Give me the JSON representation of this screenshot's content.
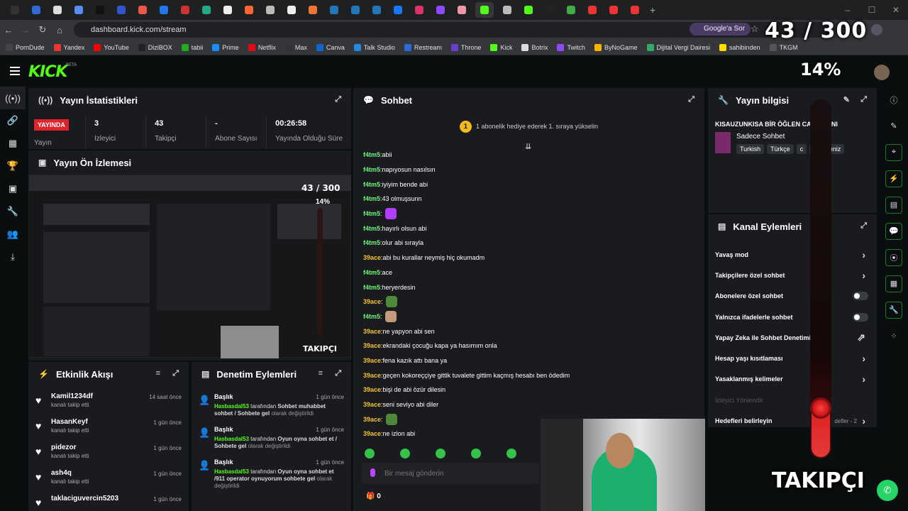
{
  "browser": {
    "url": "dashboard.kick.com/stream",
    "google_chip": "Google'a Sor",
    "bookmarks": [
      "PornDude",
      "Yandex",
      "YouTube",
      "DiziBOX",
      "tabii",
      "Prime",
      "Netflix",
      "Max",
      "Canva",
      "Talk Studio",
      "Restream",
      "Throne",
      "Kick",
      "Botrix",
      "Twitch",
      "ByNoGame",
      "Dijital Vergi Dairesi",
      "sahibinden",
      "TKGM"
    ],
    "bookmark_colors": [
      "#444",
      "#e33",
      "#f00",
      "#222",
      "#2a2",
      "#1a8cff",
      "#e50914",
      "#333",
      "#16c",
      "#2288dd",
      "#2a6bd8",
      "#6a3fd0",
      "#53fc18",
      "#ddd",
      "#9146ff",
      "#ffb400",
      "#3a6",
      "#ffdd00",
      "#555"
    ]
  },
  "header": {
    "logo": "KICK",
    "beta": "BETA"
  },
  "overlay": {
    "count": "43 / 300",
    "percent": "14%",
    "label": "TAKIPÇI",
    "progress": 0.14
  },
  "stats_panel": {
    "title": "Yayın İstatistikleri",
    "live_badge": "YAYINDA",
    "live_label": "Yayın",
    "viewers_value": "3",
    "viewers_label": "İzleyici",
    "followers_value": "43",
    "followers_label": "Takipçi",
    "subs_value": "-",
    "subs_label": "Abone Sayısı",
    "time_value": "00:26:58",
    "time_label": "Yayında Olduğu Süre"
  },
  "preview_panel": {
    "title": "Yayın Ön İzlemesi",
    "overlay_count": "43 / 300",
    "overlay_pct": "14%",
    "overlay_label": "TAKIPÇI"
  },
  "activity_panel": {
    "title": "Etkinlik Akışı",
    "items": [
      {
        "name": "Kamil1234df",
        "sub": "kanalı takip etti",
        "time": "14 saat önce"
      },
      {
        "name": "HasanKeyf",
        "sub": "kanalı takip etti",
        "time": "1 gün önce"
      },
      {
        "name": "pidezor",
        "sub": "kanalı takip etti",
        "time": "1 gün önce"
      },
      {
        "name": "ash4q",
        "sub": "kanalı takip etti",
        "time": "1 gün önce"
      },
      {
        "name": "taklaciguvercin5203",
        "sub": "",
        "time": "1 gün önce"
      }
    ]
  },
  "mod_panel": {
    "title": "Denetim Eylemleri",
    "items": [
      {
        "title": "Başlık",
        "time": "1 gün önce",
        "user": "Hasbasdal53",
        "mid": " tarafından ",
        "bold": "Sohbet muhabbet sohbet / Sohbete gel",
        "end": " olarak değiştirildi"
      },
      {
        "title": "Başlık",
        "time": "1 gün önce",
        "user": "Hasbasdal53",
        "mid": " tarafından ",
        "bold": "Oyun oyna sohbet et / Sohbete gel",
        "end": " olarak değiştirildi"
      },
      {
        "title": "Başlık",
        "time": "1 gün önce",
        "user": "Hasbasdal53",
        "mid": " tarafından ",
        "bold": "Oyun oyna sohbet et /911 operator oynuyorum sohbete gel",
        "end": " olarak değiştirildi"
      }
    ]
  },
  "chat_panel": {
    "title": "Sohbet",
    "banner_rank": "1",
    "banner": "1 abonelik hediye ederek 1. sıraya yükselin",
    "messages": [
      {
        "user": "f4tm5",
        "text": "abii",
        "c": "u1"
      },
      {
        "user": "f4tm5",
        "text": "napıyosun nasılsın",
        "c": "u1"
      },
      {
        "user": "f4tm5",
        "text": "iyiyim bende abi",
        "c": "u1"
      },
      {
        "user": "f4tm5",
        "text": "43 olmuşsunn",
        "c": "u1"
      },
      {
        "user": "f4tm5",
        "text": "",
        "c": "u1",
        "emote": "#b43cff"
      },
      {
        "user": "f4tm5",
        "text": "hayırlı olsun abi",
        "c": "u1"
      },
      {
        "user": "f4tm5",
        "text": "olur abi sırayla",
        "c": "u1"
      },
      {
        "user": "39ace",
        "text": "abi bu kurallar neymiş hiç okumadm",
        "c": "u2"
      },
      {
        "user": "f4tm5",
        "text": "ace",
        "c": "u1"
      },
      {
        "user": "f4tm5",
        "text": "heryerdesin",
        "c": "u1"
      },
      {
        "user": "39ace",
        "text": "",
        "c": "u2",
        "emote": "#4c8a3a"
      },
      {
        "user": "f4tm5",
        "text": "",
        "c": "u1",
        "emote": "#c49a7a"
      },
      {
        "user": "39ace",
        "text": "ne yapyon abi sen",
        "c": "u2"
      },
      {
        "user": "39ace",
        "text": "ekrandaki çocuğu kapa ya hasımım onla",
        "c": "u2"
      },
      {
        "user": "39ace",
        "text": "fena kazık attı bana ya",
        "c": "u2"
      },
      {
        "user": "39ace",
        "text": "geçen kokoreççiye gittik tuvalete gittim kaçmış hesabı ben ödedim",
        "c": "u2"
      },
      {
        "user": "39ace",
        "text": "bişi de abi özür dilesin",
        "c": "u2"
      },
      {
        "user": "39ace",
        "text": "seni seviyo abi diler",
        "c": "u2"
      },
      {
        "user": "39ace",
        "text": "",
        "c": "u2",
        "emote": "#4c8a3a"
      },
      {
        "user": "39ace",
        "text": "ne izlon abi",
        "c": "u2"
      }
    ],
    "input_placeholder": "Bir mesaj gönderin",
    "points": "0"
  },
  "info_panel": {
    "title": "Yayın bilgisi",
    "stream_title": "KISAUZUNKISA BİR ÖĞLEN CAN YAYINI",
    "category": "Sadece Sohbet",
    "tags": [
      "Turkish",
      "Türkçe",
      "c",
      "karadeniz"
    ]
  },
  "channel_panel": {
    "title": "Kanal Eylemleri",
    "actions": [
      {
        "label": "Yavaş mod",
        "kind": "chev"
      },
      {
        "label": "Takipçilere özel sohbet",
        "kind": "chev"
      },
      {
        "label": "Abonelere özel sohbet",
        "kind": "toggle"
      },
      {
        "label": "Yalnızca ifadelerle sohbet",
        "kind": "toggle"
      },
      {
        "label": "Yapay Zeka ile Sohbet Denetimi",
        "kind": "ext"
      },
      {
        "label": "Hesap yaşı kısıtlaması",
        "kind": "chev"
      },
      {
        "label": "Yasaklanmış kelimeler",
        "kind": "chev"
      },
      {
        "label": "İzleyici Yönlendir",
        "kind": "dim"
      },
      {
        "label": "Hedefleri belirleyin",
        "kind": "chev",
        "extra": "defler - 2"
      }
    ]
  }
}
